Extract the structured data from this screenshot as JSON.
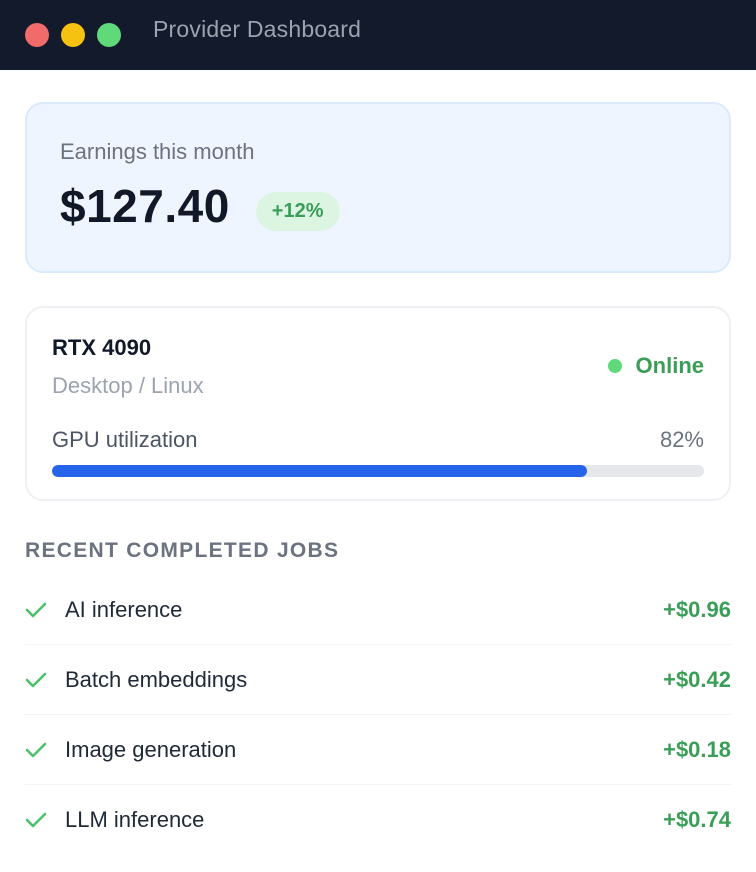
{
  "window": {
    "title": "Provider Dashboard"
  },
  "earnings": {
    "label": "Earnings this month",
    "amount": "$127.40",
    "change": "+12%"
  },
  "device": {
    "name": "RTX 4090",
    "platform": "Desktop / Linux",
    "status": "Online",
    "utilization_label": "GPU utilization",
    "utilization_text": "82%",
    "utilization_value": 0.82
  },
  "jobs": {
    "section_title": "RECENT COMPLETED JOBS",
    "items": [
      {
        "name": "AI inference",
        "amount": "+$0.96"
      },
      {
        "name": "Batch embeddings",
        "amount": "+$0.42"
      },
      {
        "name": "Image generation",
        "amount": "+$0.18"
      },
      {
        "name": "LLM inference",
        "amount": "+$0.74"
      }
    ]
  },
  "colors": {
    "titlebar": "#131a2b",
    "accent_blue": "#2563eb",
    "success_green": "#3a9e57",
    "online_dot": "#5fd97a"
  },
  "icons": {
    "job_status": "check-icon",
    "window_controls": [
      "close-dot-icon",
      "minimize-dot-icon",
      "maximize-dot-icon"
    ]
  }
}
